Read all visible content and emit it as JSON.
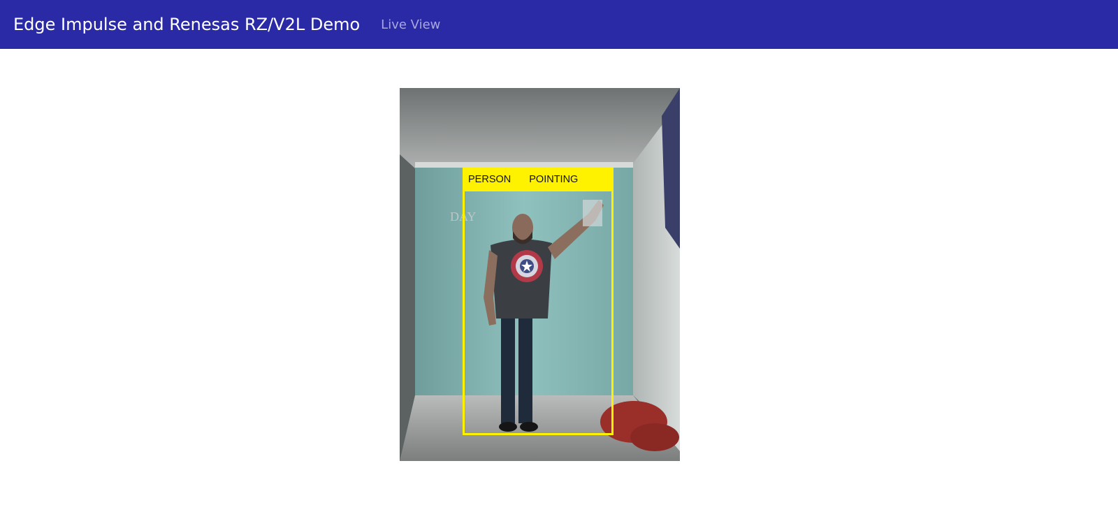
{
  "navbar": {
    "brand": "Edge Impulse and Renesas RZ/V2L Demo",
    "live_view_link": "Live View",
    "background_color": "#2b2aa6"
  },
  "camera_feed": {
    "detections": [
      {
        "label": "PERSON"
      },
      {
        "label": "POINTING"
      }
    ],
    "box_color": "#fff200"
  }
}
